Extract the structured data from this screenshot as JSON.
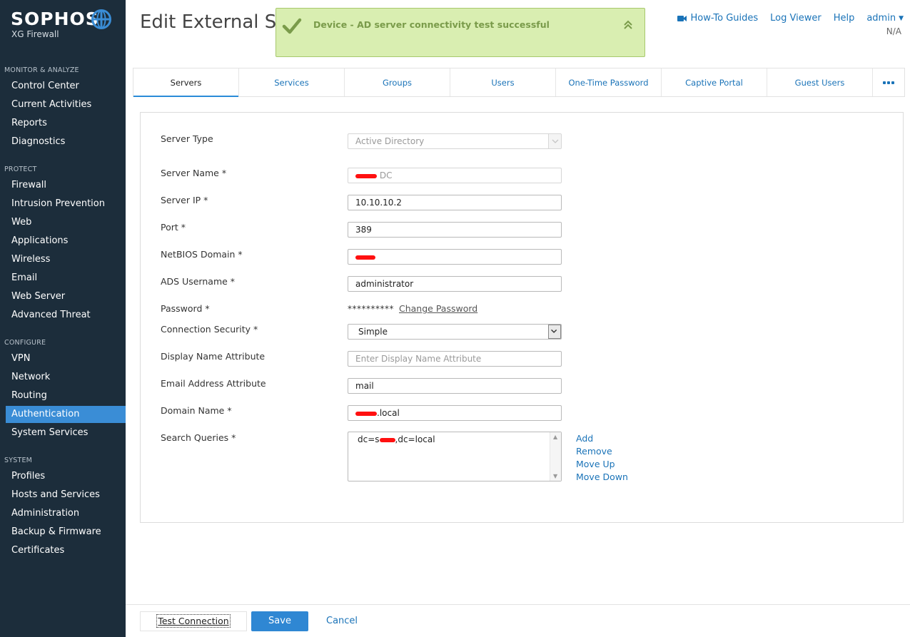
{
  "brand": {
    "name": "SOPHOS",
    "product": "XG Firewall"
  },
  "sidebar": {
    "sections": [
      {
        "title": "MONITOR & ANALYZE",
        "items": [
          "Control Center",
          "Current Activities",
          "Reports",
          "Diagnostics"
        ]
      },
      {
        "title": "PROTECT",
        "items": [
          "Firewall",
          "Intrusion Prevention",
          "Web",
          "Applications",
          "Wireless",
          "Email",
          "Web Server",
          "Advanced Threat"
        ]
      },
      {
        "title": "CONFIGURE",
        "items": [
          "VPN",
          "Network",
          "Routing",
          "Authentication",
          "System Services"
        ]
      },
      {
        "title": "SYSTEM",
        "items": [
          "Profiles",
          "Hosts and Services",
          "Administration",
          "Backup & Firmware",
          "Certificates"
        ]
      }
    ],
    "active_item": "Authentication"
  },
  "header": {
    "title": "Edit External Ser",
    "links": {
      "howto": "How-To Guides",
      "log": "Log Viewer",
      "help": "Help",
      "user": "admin"
    },
    "user_sub": "N/A"
  },
  "toast": {
    "message": "Device - AD server connectivity test successful"
  },
  "tabs": [
    "Servers",
    "Services",
    "Groups",
    "Users",
    "One-Time Password",
    "Captive Portal",
    "Guest Users"
  ],
  "active_tab": "Servers",
  "form": {
    "server_type_label": "Server Type",
    "server_type_value": "Active Directory",
    "server_name_label": "Server Name *",
    "server_name_suffix": "DC",
    "server_ip_label": "Server IP *",
    "server_ip_value": "10.10.10.2",
    "port_label": "Port *",
    "port_value": "389",
    "netbios_label": "NetBIOS Domain *",
    "ads_user_label": "ADS Username *",
    "ads_user_value": "administrator",
    "password_label": "Password *",
    "password_mask": "**********",
    "change_password": "Change Password",
    "conn_sec_label": "Connection Security *",
    "conn_sec_value": "Simple",
    "display_attr_label": "Display Name Attribute",
    "display_attr_placeholder": "Enter Display Name Attribute",
    "email_attr_label": "Email Address Attribute",
    "email_attr_value": "mail",
    "domain_label": "Domain Name *",
    "domain_suffix": ".local",
    "search_label": "Search Queries *",
    "search_prefix": "dc=s",
    "search_suffix": ",dc=local",
    "actions": {
      "add": "Add",
      "remove": "Remove",
      "move_up": "Move Up",
      "move_down": "Move Down"
    }
  },
  "footer": {
    "test": "Test Connection",
    "save": "Save",
    "cancel": "Cancel"
  },
  "colors": {
    "sidebar_bg": "#1c2d3b",
    "accent": "#2f87d3",
    "toast_bg": "#d9eeb1",
    "link": "#1a73b8"
  }
}
